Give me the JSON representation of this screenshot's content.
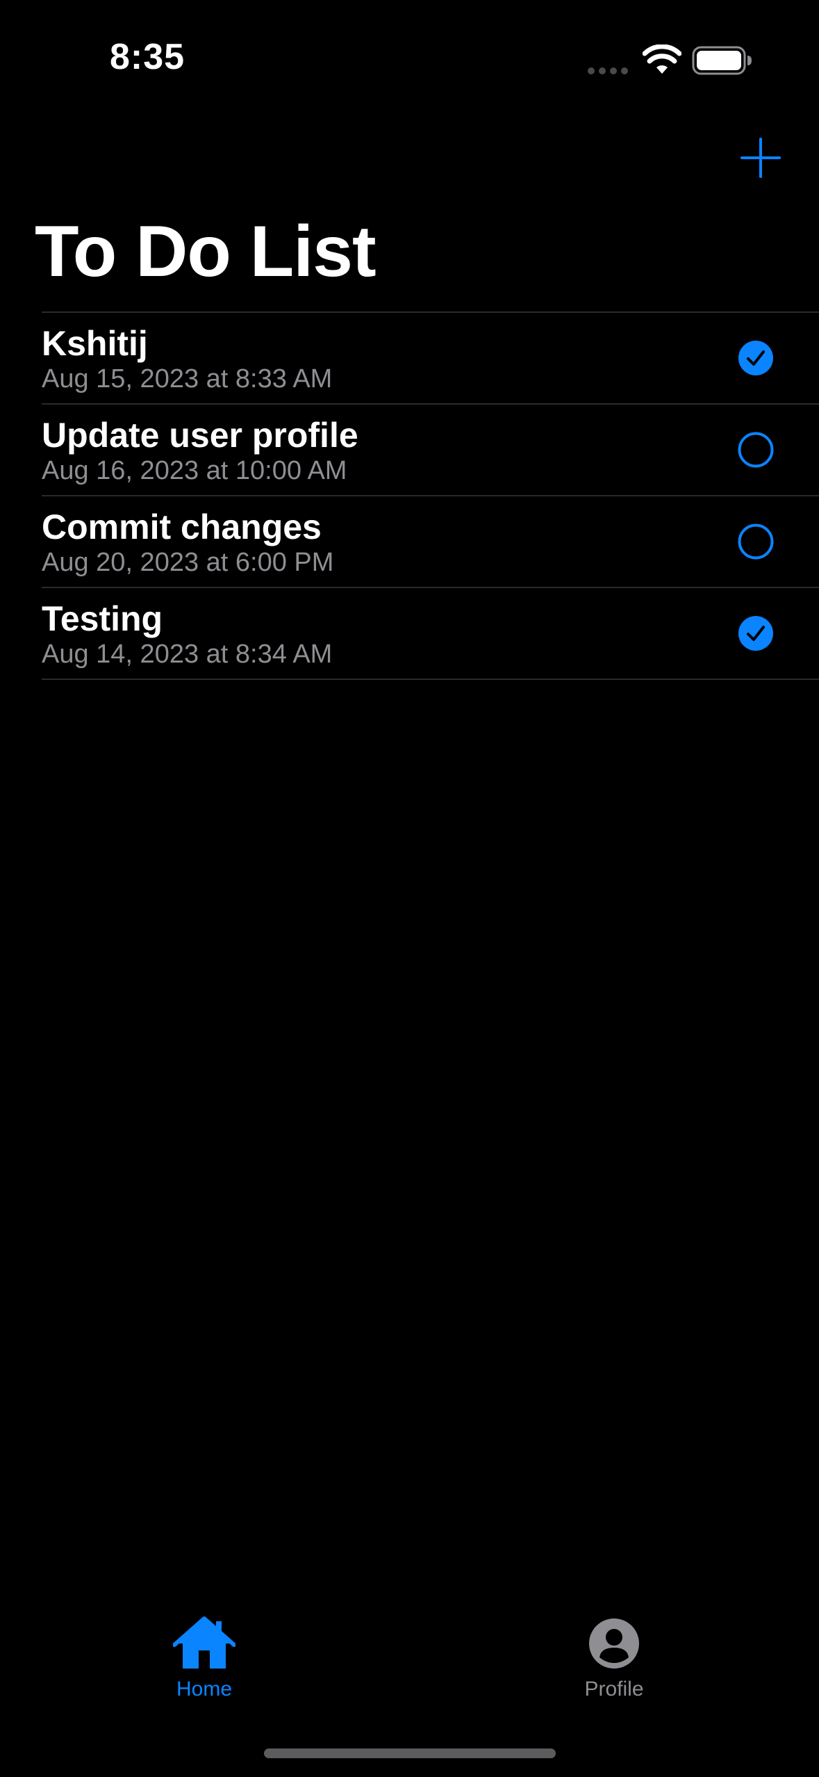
{
  "status_bar": {
    "time": "8:35"
  },
  "colors": {
    "accent": "#0a84ff",
    "background": "#000000",
    "secondary_text": "#8e8e93",
    "separator": "#2a2a2c"
  },
  "nav": {
    "add_icon": "plus-icon"
  },
  "page": {
    "title": "To Do List"
  },
  "items": [
    {
      "title": "Kshitij",
      "date": "Aug 15, 2023 at 8:33 AM",
      "done": true
    },
    {
      "title": "Update user profile",
      "date": "Aug 16, 2023 at 10:00 AM",
      "done": false
    },
    {
      "title": "Commit changes",
      "date": "Aug 20, 2023 at 6:00 PM",
      "done": false
    },
    {
      "title": "Testing",
      "date": "Aug 14, 2023 at 8:34 AM",
      "done": true
    }
  ],
  "tabs": [
    {
      "label": "Home",
      "icon": "house-icon",
      "selected": true
    },
    {
      "label": "Profile",
      "icon": "person-circle-icon",
      "selected": false
    }
  ]
}
